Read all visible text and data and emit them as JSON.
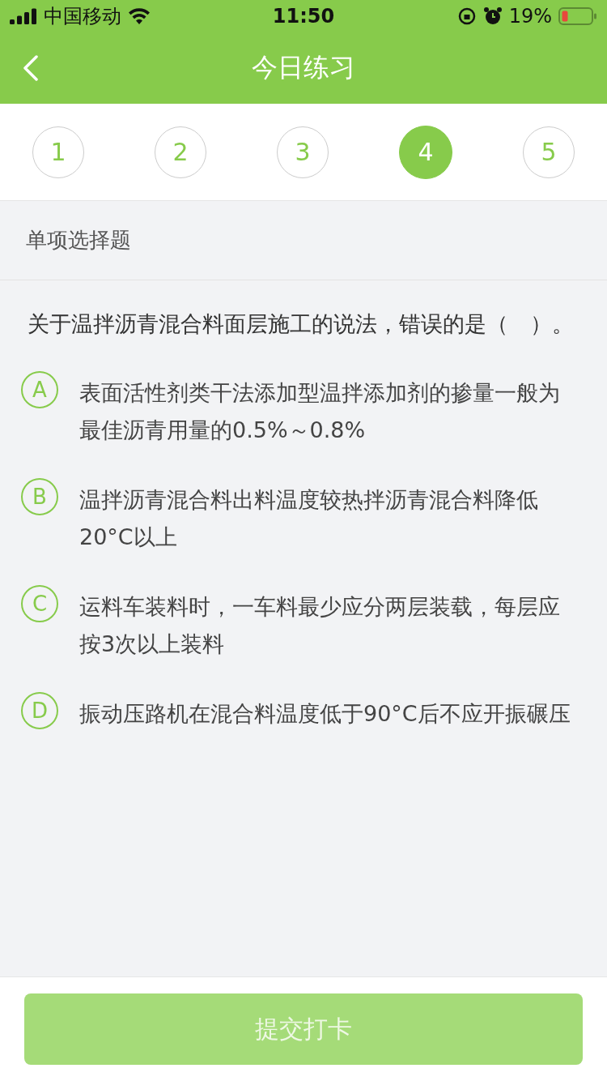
{
  "status_bar": {
    "carrier": "中国移动",
    "time": "11:50",
    "battery": "19%"
  },
  "nav": {
    "title": "今日练习"
  },
  "steps": [
    {
      "label": "1",
      "selected": false
    },
    {
      "label": "2",
      "selected": false
    },
    {
      "label": "3",
      "selected": false
    },
    {
      "label": "4",
      "selected": true
    },
    {
      "label": "5",
      "selected": false
    }
  ],
  "question": {
    "type": "单项选择题",
    "text": "关于温拌沥青混合料面层施工的说法，错误的是（　）。",
    "options": [
      {
        "letter": "A",
        "text": "表面活性剂类干法添加型温拌添加剂的掺量一般为最佳沥青用量的0.5%～0.8%",
        "selected": false
      },
      {
        "letter": "B",
        "text": "温拌沥青混合料出料温度较热拌沥青混合料降低20°C以上",
        "selected": false
      },
      {
        "letter": "C",
        "text": "运料车装料时，一车料最少应分两层装载，每层应按3次以上装料",
        "selected": false
      },
      {
        "letter": "D",
        "text": "振动压路机在混合料温度低于90°C后不应开振碾压",
        "selected": false
      }
    ]
  },
  "submit": {
    "label": "提交打卡",
    "disabled": true
  }
}
